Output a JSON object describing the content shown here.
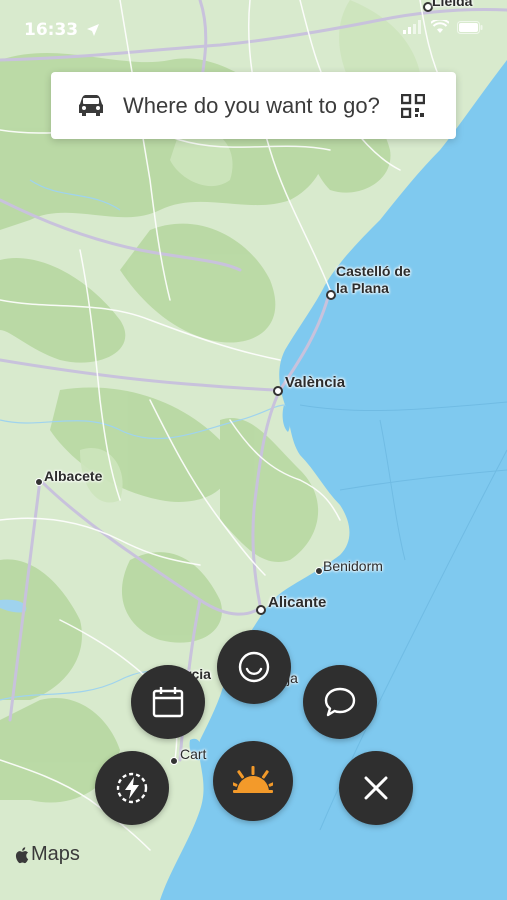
{
  "status_bar": {
    "time": "16:33",
    "icons": [
      "location-arrow-icon",
      "signal-icon",
      "wifi-icon",
      "battery-icon"
    ]
  },
  "search": {
    "placeholder": "Where do you want to go?",
    "left_icon": "car-icon",
    "right_icon": "qr-code-icon"
  },
  "map": {
    "cities": [
      {
        "name": "Lleida"
      },
      {
        "name": "Castelló de",
        "name2": "la Plana"
      },
      {
        "name": "València"
      },
      {
        "name": "Albacete"
      },
      {
        "name": "Benidorm"
      },
      {
        "name": "Alicante"
      },
      {
        "name": "Murcia",
        "visible": "rcia"
      },
      {
        "name": "Cartagena",
        "visible": "Cart"
      },
      {
        "name": "Torrevieja",
        "visible": "ja"
      }
    ],
    "colors": {
      "land": "#d9ead0",
      "forest": "#b8d9a2",
      "water": "#7ec8ef",
      "roads": "#ffffff",
      "highway": "#c9c3dc"
    }
  },
  "actions": {
    "buttons": [
      "calendar-icon",
      "smiley-icon",
      "chat-bubble-icon",
      "flash-icon",
      "sunrise-logo-icon",
      "close-icon"
    ]
  },
  "attribution": {
    "text": "Maps"
  }
}
